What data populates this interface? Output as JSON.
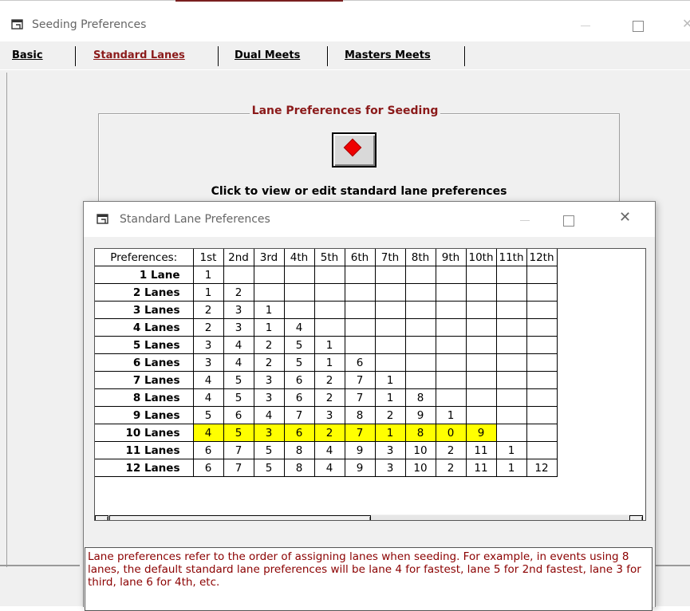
{
  "main_window": {
    "title": "Seeding Preferences",
    "tabs": [
      {
        "label": "Basic",
        "active": false
      },
      {
        "label": "Standard Lanes",
        "active": true
      },
      {
        "label": "Dual Meets",
        "active": false
      },
      {
        "label": "Masters Meets",
        "active": false
      }
    ],
    "group_title": "Lane Preferences for Seeding",
    "click_text": "Click to view or edit standard lane preferences"
  },
  "dialog": {
    "title": "Standard Lane Preferences",
    "columns": [
      "Preferences:",
      "1st",
      "2nd",
      "3rd",
      "4th",
      "5th",
      "6th",
      "7th",
      "8th",
      "9th",
      "10th",
      "11th",
      "12th"
    ],
    "rows": [
      {
        "label": "1 Lane",
        "values": [
          "1"
        ]
      },
      {
        "label": "2 Lanes",
        "values": [
          "1",
          "2"
        ]
      },
      {
        "label": "3 Lanes",
        "values": [
          "2",
          "3",
          "1"
        ]
      },
      {
        "label": "4 Lanes",
        "values": [
          "2",
          "3",
          "1",
          "4"
        ]
      },
      {
        "label": "5 Lanes",
        "values": [
          "3",
          "4",
          "2",
          "5",
          "1"
        ]
      },
      {
        "label": "6 Lanes",
        "values": [
          "3",
          "4",
          "2",
          "5",
          "1",
          "6"
        ]
      },
      {
        "label": "7 Lanes",
        "values": [
          "4",
          "5",
          "3",
          "6",
          "2",
          "7",
          "1"
        ]
      },
      {
        "label": "8 Lanes",
        "values": [
          "4",
          "5",
          "3",
          "6",
          "2",
          "7",
          "1",
          "8"
        ]
      },
      {
        "label": "9 Lanes",
        "values": [
          "5",
          "6",
          "4",
          "7",
          "3",
          "8",
          "2",
          "9",
          "1"
        ]
      },
      {
        "label": "10 Lanes",
        "values": [
          "4",
          "5",
          "3",
          "6",
          "2",
          "7",
          "1",
          "8",
          "0",
          "9"
        ],
        "highlighted": true
      },
      {
        "label": "11 Lanes",
        "values": [
          "6",
          "7",
          "5",
          "8",
          "4",
          "9",
          "3",
          "10",
          "2",
          "11",
          "1"
        ]
      },
      {
        "label": "12 Lanes",
        "values": [
          "6",
          "7",
          "5",
          "8",
          "4",
          "9",
          "3",
          "10",
          "2",
          "11",
          "1",
          "12"
        ]
      }
    ],
    "highlight_color": "#ffff00",
    "info_text": "Lane preferences refer to the order of assigning lanes when seeding. For example, in events using 8 lanes, the default standard lane preferences will be lane 4 for fastest, lane 5 for 2nd fastest, lane 3 for third, lane 6 for 4th, etc.",
    "info_text_color": "#8b0000"
  },
  "icons": {
    "app": "window-app-icon",
    "lane_button": "red-diamond-icon",
    "scroll_left": "arrow-left-icon",
    "scroll_right": "arrow-right-icon"
  }
}
